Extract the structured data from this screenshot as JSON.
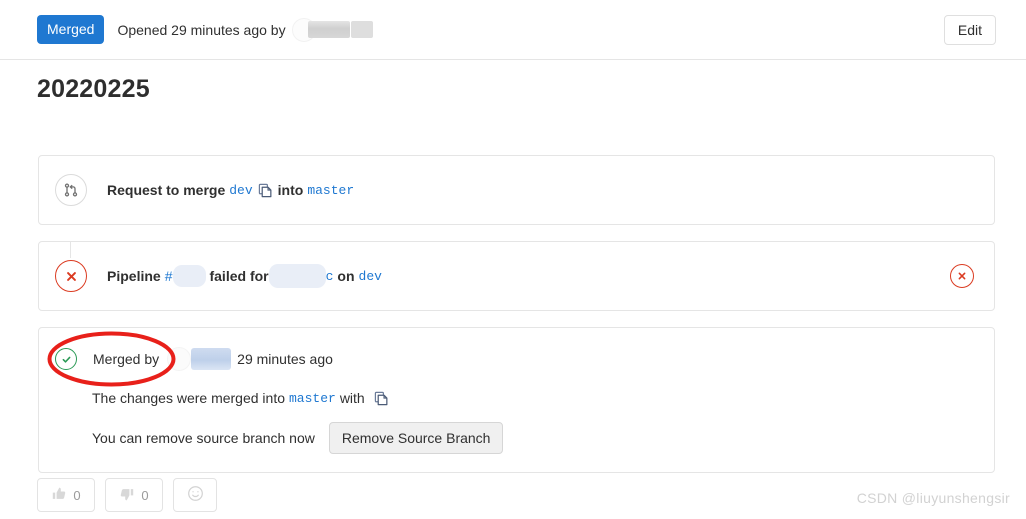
{
  "header": {
    "status_badge": "Merged",
    "opened_text": "Opened 29 minutes ago by",
    "author_redacted": true,
    "edit_label": "Edit",
    "badge_color": "#1f78d1"
  },
  "title": "20220225",
  "merge_request": {
    "request_row": {
      "icon": "merge-request-icon",
      "prefix": "Request to merge",
      "source_branch": "dev",
      "copy_icon": "copy-icon",
      "middle": "into",
      "target_branch": "master"
    },
    "pipeline_row": {
      "icon": "error-circle-icon",
      "prefix": "Pipeline",
      "hash_symbol": "#",
      "pipeline_id_redacted": "",
      "failed_text": "failed for",
      "commit_sha_redacted": "",
      "commit_sha_visible": "c",
      "on_text": "on",
      "branch": "dev",
      "status_icon": "error-circle-icon",
      "status_color": "#db3b21"
    },
    "merged_row": {
      "icon": "check-circle-icon",
      "status_color": "#2a9a55",
      "label": "Merged by",
      "user_redacted": "",
      "time": "29 minutes ago",
      "detail_prefix": "The changes were merged into",
      "detail_branch": "master",
      "detail_suffix": "with",
      "detail_copy_icon": "copy-icon",
      "remove_text": "You can remove source branch now",
      "remove_button": "Remove Source Branch"
    }
  },
  "reactions": [
    {
      "icon": "thumbs-up-icon",
      "count": "0"
    },
    {
      "icon": "thumbs-down-icon",
      "count": "0"
    },
    {
      "icon": "emoji-smiley-icon",
      "count": ""
    }
  ],
  "annotation": {
    "shape": "ellipse",
    "color": "#e8201a",
    "target": "Merged by"
  },
  "watermark": "CSDN @liuyunshengsir"
}
